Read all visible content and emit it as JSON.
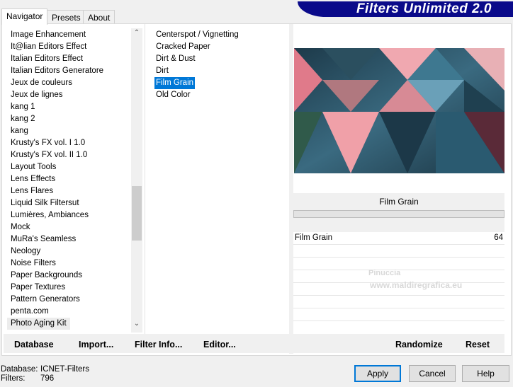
{
  "app": {
    "title": "Filters Unlimited 2.0"
  },
  "tabs": [
    {
      "label": "Navigator"
    },
    {
      "label": "Presets"
    },
    {
      "label": "About"
    }
  ],
  "categories": [
    "Image Enhancement",
    "It@lian Editors Effect",
    "Italian Editors Effect",
    "Italian Editors Generatore",
    "Jeux de couleurs",
    "Jeux de lignes",
    "kang 1",
    "kang 2",
    "kang",
    "Krusty's FX vol. I 1.0",
    "Krusty's FX vol. II 1.0",
    "Layout Tools",
    "Lens Effects",
    "Lens Flares",
    "Liquid Silk Filtersut",
    "Lumières, Ambiances",
    "Mock",
    "MuRa's Seamless",
    "Neology",
    "Noise Filters",
    "Paper Backgrounds",
    "Paper Textures",
    "Pattern Generators",
    "penta.com",
    "Photo Aging Kit"
  ],
  "selected_category": "Photo Aging Kit",
  "filters": [
    "Centerspot / Vignetting",
    "Cracked Paper",
    "Dirt & Dust",
    "Dirt",
    "Film Grain",
    "Old Color"
  ],
  "selected_filter": "Film Grain",
  "params": {
    "header": "Film Grain",
    "rows": [
      {
        "label": "Film Grain",
        "value": "64"
      }
    ]
  },
  "left_buttons": {
    "database": "Database",
    "import": "Import...",
    "filter_info": "Filter Info...",
    "editor": "Editor..."
  },
  "right_buttons": {
    "randomize": "Randomize",
    "reset": "Reset"
  },
  "status": {
    "database_label": "Database:",
    "database_value": "ICNET-Filters",
    "filters_label": "Filters:",
    "filters_value": "796"
  },
  "dialog_buttons": {
    "apply": "Apply",
    "cancel": "Cancel",
    "help": "Help"
  },
  "watermark": {
    "name": "Pinuccia",
    "url": "www.maldiregrafica.eu"
  }
}
